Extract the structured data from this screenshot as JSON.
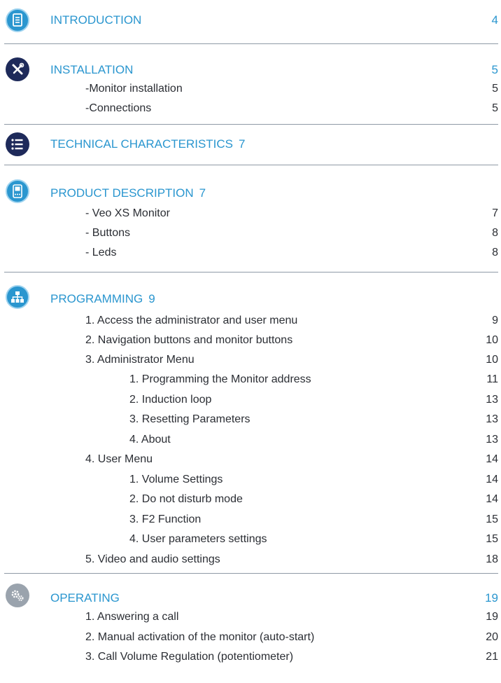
{
  "colors": {
    "accent": "#2a96cf",
    "navy": "#1e2a5a",
    "grey": "#9aa3ad"
  },
  "sections": {
    "introduction": {
      "title": "INTRODUCTION",
      "page": "4",
      "icon": "document-icon"
    },
    "installation": {
      "title": "INSTALLATION",
      "page": "5",
      "icon": "tools-icon",
      "items": [
        {
          "label": "-Monitor installation",
          "page": "5"
        },
        {
          "label": "-Connections",
          "page": "5"
        }
      ]
    },
    "technical": {
      "title": "TECHNICAL CHARACTERISTICS",
      "page": "7",
      "icon": "list-icon"
    },
    "product": {
      "title": "PRODUCT DESCRIPTION",
      "page": "7",
      "icon": "monitor-icon",
      "items": [
        {
          "label": "- Veo XS Monitor",
          "page": "7"
        },
        {
          "label": "- Buttons",
          "page": "8"
        },
        {
          "label": "- Leds",
          "page": "8"
        }
      ]
    },
    "programming": {
      "title": "PROGRAMMING",
      "page": "9",
      "icon": "sitemap-icon",
      "items": [
        {
          "label": "1. Access the administrator and user menu",
          "page": "9"
        },
        {
          "label": "2. Navigation buttons and monitor buttons",
          "page": "10"
        },
        {
          "label": "3. Administrator Menu",
          "page": "10"
        },
        {
          "label": "1. Programming the Monitor address",
          "page": "11"
        },
        {
          "label": "2. Induction loop",
          "page": "13"
        },
        {
          "label": "3. Resetting Parameters",
          "page": "13"
        },
        {
          "label": "4. About",
          "page": "13"
        },
        {
          "label": "4. User Menu",
          "page": "14"
        },
        {
          "label": "1. Volume Settings",
          "page": "14"
        },
        {
          "label": "2. Do not disturb mode",
          "page": "14"
        },
        {
          "label": "3. F2 Function",
          "page": "15"
        },
        {
          "label": "4. User parameters settings",
          "page": "15"
        },
        {
          "label": "5. Video and audio settings",
          "page": "18"
        }
      ]
    },
    "operating": {
      "title": "OPERATING",
      "page": "19",
      "icon": "gears-icon",
      "items": [
        {
          "label": "1. Answering a call",
          "page": "19"
        },
        {
          "label": "2. Manual activation of the monitor (auto-start)",
          "page": "20"
        },
        {
          "label": "3. Call Volume Regulation (potentiometer)",
          "page": "21"
        }
      ]
    }
  }
}
